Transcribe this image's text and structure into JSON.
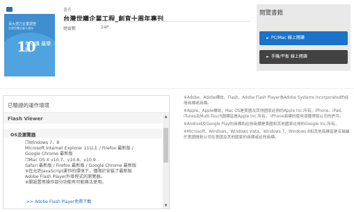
{
  "cover": {
    "top_text": "百大潛力企業調查",
    "small_text": "台灣世曦企業十週年",
    "big_number": "10",
    "big_text": "年守護 最樂開"
  },
  "info": {
    "name_label": "書名",
    "title": "台灣世曦企業工程_創育十周年專刊",
    "pages_label": "總頁數",
    "pages_value": "24P"
  },
  "reader_panel": {
    "title": "閱覽書籍",
    "pc_button": "PC/Mac 線上閱讀",
    "mobile_button": "手機/平板 線上閱讀",
    "arrow": "►"
  },
  "environment": {
    "header": "已驗證的運作環境",
    "section": "Flash Viewer",
    "subsection": "OS及瀏覽器",
    "lines": [
      "❒Windows 7、8",
      "Microsoft Internet Explorer 11以上 / Firefox 最新版 /",
      "Google Chrome 最新版",
      "❒Mac OS X v10.7、v10.8、v10.9",
      "Safari 最新版 / Firefox 最新版 / Google Chrome 最新版",
      "※在允許JavaScript運作的環境下，僅限於安裝了最新版",
      "Adobe Flash Player外掛程式的瀏覽器。",
      "※關設置等操作部分功能有可能無法使用。"
    ],
    "download_link": ">> Adobe Flash Player免費下載"
  },
  "notes": [
    "※Adobe、Adobe標誌、Flash、Adobe Flash Player為Adobe Systems Incorporated的註冊商標或商標。",
    "※Apple、Apple標誌、Mac OS是美國及其他國家註冊的Apple Inc.所有。iPhone、iPad、iTunes及Multi-Touch圖標皆是Apple Inc.所有。 iPhone商標的使用須獲得取公司的許可。",
    "※Android及Google Play的商標和註冊商標是美國和其他國家註冊的Google Inc.所有。",
    "※Microsoft、Windows、Windows Vista、Windows 7、Windows 8和其他商標皆是名稱屬於美國微軟公司在美國及其他國家的商標或註冊商標。"
  ]
}
